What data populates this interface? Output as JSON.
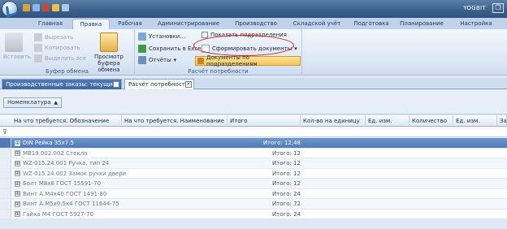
{
  "app": {
    "title": "YOGBIT",
    "restore_glyph": "❐"
  },
  "ribbon_tabs": [
    "Главная",
    "Правка",
    "Рабочая",
    "Администрирование",
    "Производство",
    "Складской учёт",
    "Подготовка",
    "Планирование",
    "Настройка"
  ],
  "active_tab": "Правка",
  "clipboard": {
    "paste": "Вставить",
    "cut": "Вырезать",
    "copy": "Копировать",
    "select_all": "Выделить все",
    "preview": "Просмотр буфера обмена",
    "label": "Буфер обмена"
  },
  "needs": {
    "settings": "Установки...",
    "save_excel": "Сохранить в Exce",
    "reports": "Отчёты",
    "show_subdivisions": "Показать подразделения",
    "form_documents": "Сформировать документы",
    "documents_by_subdivision": "Документы по подразделениям",
    "label": "Расчёт потребности",
    "dropdown_arrow": "▾"
  },
  "doc_tabs": [
    "Производственные заказы: текущие",
    "Расчёт потребности"
  ],
  "close_glyph": "×",
  "group_panel": {
    "chip": "Номенклатура",
    "sort_glyph": "▲"
  },
  "columns": [
    "На что требуется. Обозначение",
    "На что требуется. Наименование",
    "Итого",
    "Кол-во на единицу",
    "Ед. изм.",
    "Количество",
    "Ед. изм.",
    "Зам"
  ],
  "filter_glyph": "⊽",
  "expander_glyph": "⊞",
  "rows": [
    {
      "label": "DIN Рейка 35х7.5",
      "total": "Итого: 12,48",
      "selected": true
    },
    {
      "label": "MB19.002.002 Стекло",
      "total": "Итого: 12"
    },
    {
      "label": "WZ-015.24.001 Ручка, тип 24",
      "total": "Итого: 12"
    },
    {
      "label": "WZ-015.24.002 Замок ручки двери",
      "total": "Итого: 12"
    },
    {
      "label": "Болт М8х8 ГОСТ 15591-70",
      "total": "Итого: 12"
    },
    {
      "label": "Винт А.М4х40 ГОСТ 1491-80",
      "total": "Итого: 24"
    },
    {
      "label": "Винт А.М5х0,5х4 ГОСТ 11644-75",
      "total": "Итого: 72"
    },
    {
      "label": "Гайка М4 ГОСТ 5927-70",
      "total": "Итого: 24"
    }
  ],
  "colors": {
    "accent": "#4f7ab6",
    "highlight_ring": "#e11a1a",
    "dropdown_highlight": "#f7c55b"
  }
}
